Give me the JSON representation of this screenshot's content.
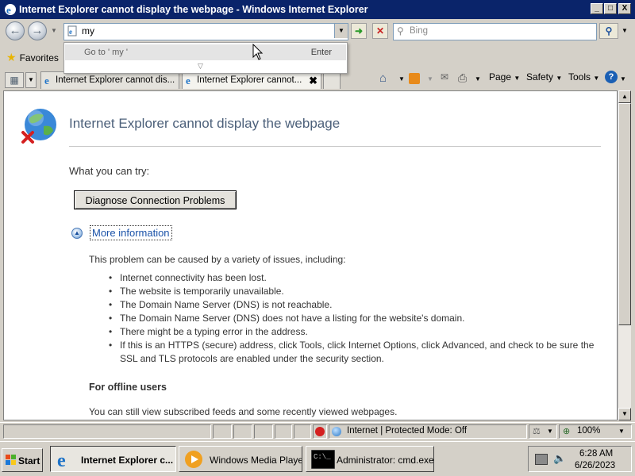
{
  "window": {
    "title": "Internet Explorer cannot display the webpage - Windows Internet Explorer",
    "caption_buttons": [
      "_",
      "□",
      "X"
    ]
  },
  "address_bar": {
    "value": "my",
    "search_placeholder": "Bing"
  },
  "autocomplete": {
    "goto_text": "Go to ' my '",
    "enter_label": "Enter"
  },
  "favorites_label": "Favorites",
  "tabs": [
    {
      "label": "Internet Explorer cannot dis...",
      "active": false
    },
    {
      "label": "Internet Explorer cannot...",
      "active": true
    }
  ],
  "command_bar": {
    "page": "Page",
    "safety": "Safety",
    "tools": "Tools"
  },
  "page": {
    "heading": "Internet Explorer cannot display the webpage",
    "try_label": "What you can try:",
    "diagnose_button": "Diagnose Connection Problems",
    "more_info": "More information",
    "cause_intro": "This problem can be caused by a variety of issues, including:",
    "causes": [
      "Internet connectivity has been lost.",
      "The website is temporarily unavailable.",
      "The Domain Name Server (DNS) is not reachable.",
      "The Domain Name Server (DNS) does not have a listing for the website's domain.",
      "There might be a typing error in the address.",
      "If this is an HTTPS (secure) address, click Tools, click Internet Options, click Advanced, and check to be sure the SSL and TLS protocols are enabled under the security section."
    ],
    "offline_heading": "For offline users",
    "offline_text": "You can still view subscribed feeds and some recently viewed webpages."
  },
  "status_bar": {
    "zone": "Internet | Protected Mode: Off",
    "zoom": "100%"
  },
  "taskbar": {
    "start": "Start",
    "items": [
      {
        "label": "Internet Explorer c...",
        "active": true
      },
      {
        "label": "Windows Media Player",
        "active": false
      },
      {
        "label": "Administrator: cmd.exe",
        "active": false
      }
    ],
    "time": "6:28 AM",
    "date": "6/26/2023"
  },
  "colors": {
    "titlebar": "#0a246a",
    "heading": "#4c607a",
    "link": "#1a52a8"
  }
}
